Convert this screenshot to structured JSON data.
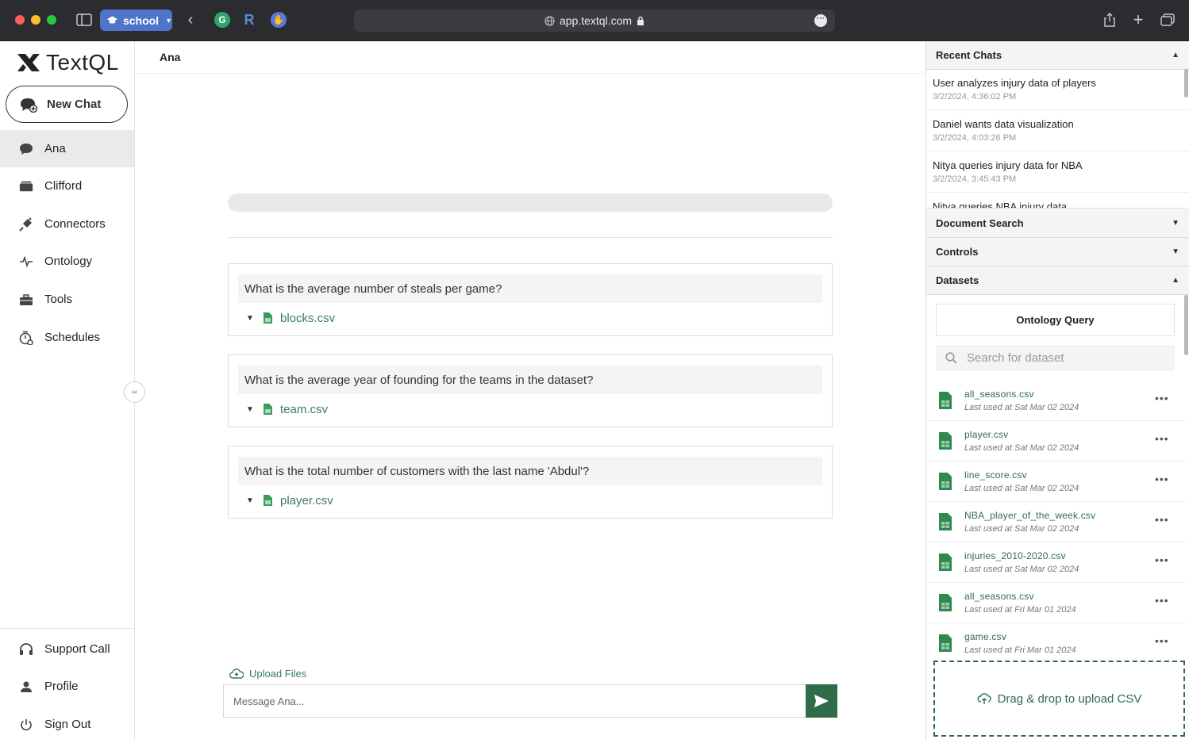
{
  "browser": {
    "profile": "school",
    "url": "app.textql.com",
    "extensions": [
      "G",
      "R",
      "✋"
    ]
  },
  "sidebar": {
    "logo_text": "TextQL",
    "new_chat": "New Chat",
    "items": [
      {
        "label": "Ana",
        "icon": "chat-bubble-icon",
        "active": true
      },
      {
        "label": "Clifford",
        "icon": "folder-icon"
      },
      {
        "label": "Connectors",
        "icon": "plug-icon"
      },
      {
        "label": "Ontology",
        "icon": "ontology-icon"
      },
      {
        "label": "Tools",
        "icon": "toolbox-icon"
      },
      {
        "label": "Schedules",
        "icon": "schedule-icon"
      }
    ],
    "bottom": [
      {
        "label": "Support Call",
        "icon": "headset-icon"
      },
      {
        "label": "Profile",
        "icon": "person-icon"
      },
      {
        "label": "Sign Out",
        "icon": "power-icon"
      }
    ]
  },
  "main": {
    "title": "Ana",
    "questions": [
      {
        "text": "What is the average number of steals per game?",
        "file": "blocks.csv"
      },
      {
        "text": "What is the average year of founding for the teams in the dataset?",
        "file": "team.csv"
      },
      {
        "text": "What is the total number of customers with the last name 'Abdul'?",
        "file": "player.csv"
      }
    ],
    "upload_label": "Upload Files",
    "message_placeholder": "Message Ana..."
  },
  "right_panel": {
    "recent_chats": {
      "title": "Recent Chats",
      "items": [
        {
          "title": "User analyzes injury data of players",
          "date": "3/2/2024, 4:36:02 PM"
        },
        {
          "title": "Daniel wants data visualization",
          "date": "3/2/2024, 4:03:26 PM"
        },
        {
          "title": "Nitya queries injury data for NBA",
          "date": "3/2/2024, 3:45:43 PM"
        },
        {
          "title": "Nitya queries NBA injury data",
          "date": ""
        }
      ]
    },
    "document_search": "Document Search",
    "controls": "Controls",
    "datasets": {
      "title": "Datasets",
      "ontology_query": "Ontology Query",
      "search_placeholder": "Search for dataset",
      "items": [
        {
          "name": "all_seasons.csv",
          "used": "Last used at Sat Mar 02 2024"
        },
        {
          "name": "player.csv",
          "used": "Last used at Sat Mar 02 2024"
        },
        {
          "name": "line_score.csv",
          "used": "Last used at Sat Mar 02 2024"
        },
        {
          "name": "NBA_player_of_the_week.csv",
          "used": "Last used at Sat Mar 02 2024"
        },
        {
          "name": "injuries_2010-2020.csv",
          "used": "Last used at Sat Mar 02 2024"
        },
        {
          "name": "all_seasons.csv",
          "used": "Last used at Fri Mar 01 2024"
        },
        {
          "name": "game.csv",
          "used": "Last used at Fri Mar 01 2024"
        }
      ],
      "dropzone": "Drag & drop to upload CSV"
    }
  },
  "colors": {
    "accent": "#2f6d4a",
    "profile_pill": "#4f74c9"
  }
}
